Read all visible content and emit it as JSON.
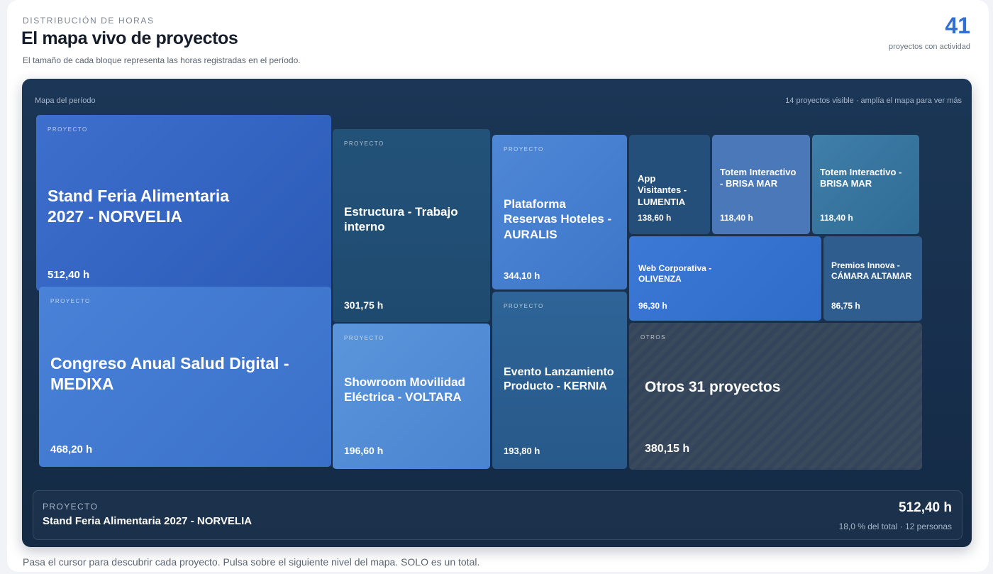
{
  "header": {
    "eyebrow": "DISTRIBUCIÓN DE HORAS",
    "title": "El mapa vivo de proyectos",
    "subtitle": "El tamaño de cada bloque representa las horas registradas en el período.",
    "count": "41",
    "count_label": "proyectos con actividad"
  },
  "map": {
    "title": "Mapa del período",
    "hint": "14 proyectos visible · amplía el mapa para ver más",
    "tiles": [
      {
        "tag": "PROYECTO",
        "name": "Stand Feria Alimentaria 2027 - NORVELIA",
        "hours": "512,40 h"
      },
      {
        "tag": "PROYECTO",
        "name": "Congreso Anual Salud Digital - MEDIXA",
        "hours": "468,20 h"
      },
      {
        "tag": "PROYECTO",
        "name": "Estructura - Trabajo interno",
        "hours": "301,75 h"
      },
      {
        "tag": "PROYECTO",
        "name": "Showroom Movilidad Eléctrica - VOLTARA",
        "hours": "196,60 h"
      },
      {
        "tag": "PROYECTO",
        "name": "Plataforma Reservas Hoteles - AURALIS",
        "hours": "344,10 h"
      },
      {
        "tag": "PROYECTO",
        "name": "Evento Lanzamiento Producto - KERNIA",
        "hours": "193,80 h"
      },
      {
        "tag": "",
        "name": "App Visitantes - LUMENTIA",
        "hours": "138,60 h"
      },
      {
        "tag": "",
        "name": "Totem Interactivo - BRISA MAR",
        "hours": "118,40 h"
      },
      {
        "tag": "",
        "name": "Totem Interactivo - BRISA MAR",
        "hours": "118,40 h"
      },
      {
        "tag": "",
        "name": "Web Corporativa - OLIVENZA",
        "hours": "96,30 h"
      },
      {
        "tag": "",
        "name": "Premios Innova - CÁMARA ALTAMAR",
        "hours": "86,75 h"
      },
      {
        "tag": "OTROS",
        "name": "Otros 31 proyectos",
        "hours": "380,15 h"
      }
    ]
  },
  "detail": {
    "label": "PROYECTO",
    "name": "Stand Feria Alimentaria 2027 - NORVELIA",
    "hours": "512,40 h",
    "meta": "18,0 % del total · 12 personas"
  },
  "footer": "Pasa el cursor para descubrir cada proyecto. Pulsa sobre el siguiente nivel del mapa. SOLO es un total."
}
